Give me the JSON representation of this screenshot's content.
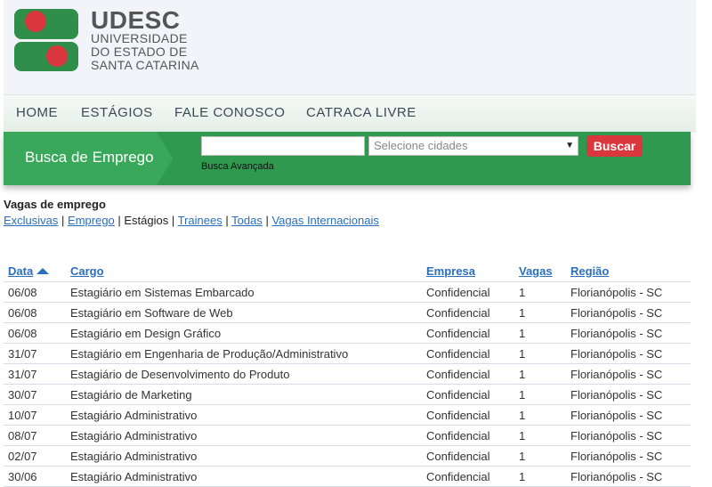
{
  "brand": {
    "name": "UDESC",
    "line1": "UNIVERSIDADE",
    "line2": "DO ESTADO DE",
    "line3": "SANTA CATARINA"
  },
  "nav": [
    "HOME",
    "ESTÁGIOS",
    "FALE CONOSCO",
    "CATRACA LIVRE"
  ],
  "search": {
    "section_label": "Busca de Emprego",
    "query_value": "",
    "city_placeholder": "Selecione cidades",
    "button": "Buscar",
    "advanced": "Busca Avançada"
  },
  "listing": {
    "title": "Vagas de emprego",
    "filters": [
      "Exclusivas",
      "Emprego",
      "Estágios",
      "Trainees",
      "Todas",
      "Vagas Internacionais"
    ],
    "active_filter": "Estágios",
    "columns": [
      "Data",
      "Cargo",
      "Empresa",
      "Vagas",
      "Região"
    ],
    "rows": [
      [
        "06/08",
        "Estagiário em Sistemas Embarcado",
        "Confidencial",
        "1",
        "Florianópolis - SC"
      ],
      [
        "06/08",
        "Estagiário em Software de Web",
        "Confidencial",
        "1",
        "Florianópolis - SC"
      ],
      [
        "06/08",
        "Estagiário em Design Gráfico",
        "Confidencial",
        "1",
        "Florianópolis - SC"
      ],
      [
        "31/07",
        "Estagiário em Engenharia de Produção/Administrativo",
        "Confidencial",
        "1",
        "Florianópolis - SC"
      ],
      [
        "31/07",
        "Estagiário de Desenvolvimento do Produto",
        "Confidencial",
        "1",
        "Florianópolis - SC"
      ],
      [
        "30/07",
        "Estagiário de Marketing",
        "Confidencial",
        "1",
        "Florianópolis - SC"
      ],
      [
        "10/07",
        "Estagiário Administrativo",
        "Confidencial",
        "1",
        "Florianópolis - SC"
      ],
      [
        "08/07",
        "Estagiário Administrativo",
        "Confidencial",
        "1",
        "Florianópolis - SC"
      ],
      [
        "02/07",
        "Estagiário Administrativo",
        "Confidencial",
        "1",
        "Florianópolis - SC"
      ],
      [
        "30/06",
        "Estagiário Administrativo",
        "Confidencial",
        "1",
        "Florianópolis - SC"
      ]
    ]
  },
  "colors": {
    "logo_green": "#2f8f4a",
    "logo_red": "#d9363e",
    "search_bar": "#2f9a4f",
    "button": "#d9363e",
    "link": "#2a6fbd"
  }
}
